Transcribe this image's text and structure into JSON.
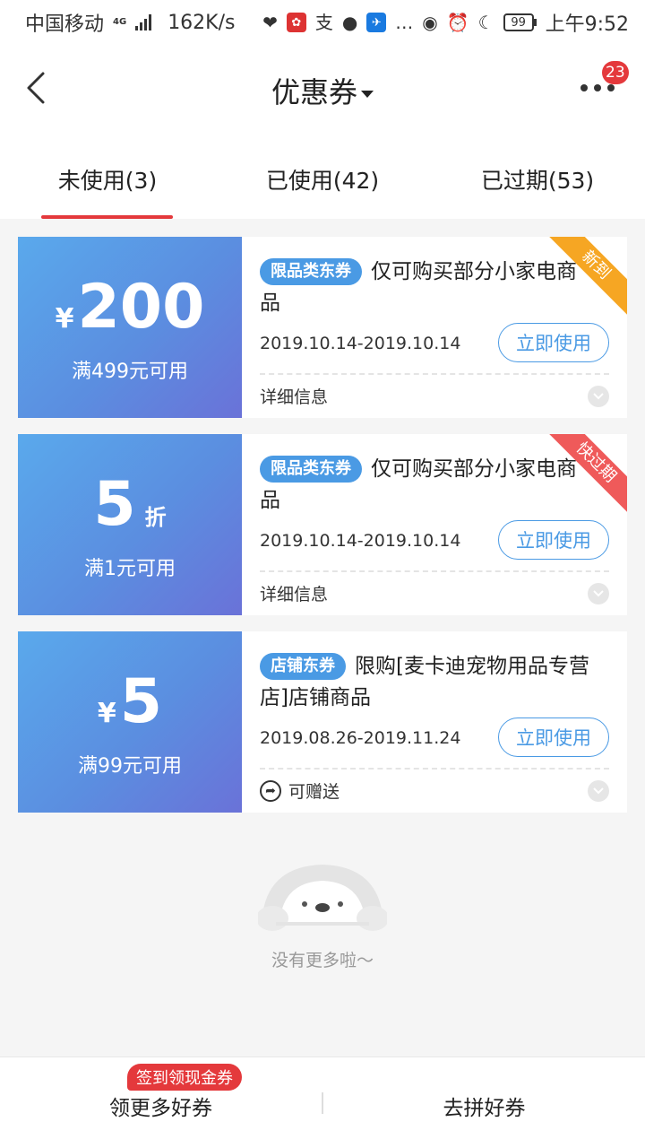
{
  "status_bar": {
    "carrier": "中国移动",
    "network": "4G",
    "speed": "162K/s",
    "icons": [
      "signal-icon",
      "heart-rate-icon",
      "app-icon",
      "alipay-icon",
      "chat-icon",
      "app-icon",
      "more-icon",
      "eye-icon",
      "alarm-icon",
      "moon-icon"
    ],
    "battery": "99",
    "time": "上午9:52"
  },
  "header": {
    "title": "优惠券",
    "badge": "23"
  },
  "tabs": [
    {
      "label": "未使用(3)",
      "active": true
    },
    {
      "label": "已使用(42)",
      "active": false
    },
    {
      "label": "已过期(53)",
      "active": false
    }
  ],
  "coupons": [
    {
      "currency": "¥",
      "amount": "200",
      "unit": "",
      "condition": "满499元可用",
      "tag": "限品类东券",
      "desc": "仅可购买部分小家电商品",
      "date": "2019.10.14-2019.10.14",
      "button": "立即使用",
      "footer": "详细信息",
      "ribbon": "新到"
    },
    {
      "currency": "",
      "amount": "5",
      "unit": "折",
      "condition": "满1元可用",
      "tag": "限品类东券",
      "desc": "仅可购买部分小家电商品",
      "date": "2019.10.14-2019.10.14",
      "button": "立即使用",
      "footer": "详细信息",
      "ribbon": "快过期"
    },
    {
      "currency": "¥",
      "amount": "5",
      "unit": "",
      "condition": "满99元可用",
      "tag": "店铺东券",
      "desc": "限购[麦卡迪宠物用品专营店]店铺商品",
      "date": "2019.08.26-2019.11.24",
      "button": "立即使用",
      "footer": "可赠送",
      "ribbon": ""
    }
  ],
  "empty": {
    "text": "没有更多啦～"
  },
  "bottom_bar": {
    "promo": "签到领现金券",
    "left": "领更多好券",
    "right": "去拼好券"
  },
  "colors": {
    "accent_red": "#e4393c",
    "coupon_blue": "#4a9ae4",
    "ribbon_orange": "#f6a623",
    "ribbon_red": "#ef5a5a"
  }
}
